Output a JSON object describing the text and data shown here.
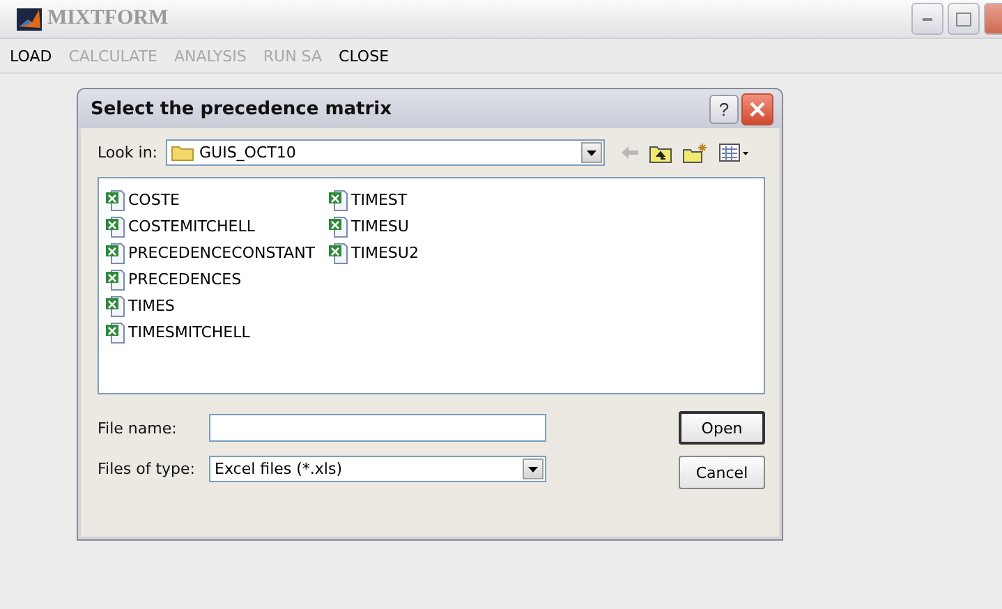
{
  "window": {
    "title": "MIXTFORM"
  },
  "menu": [
    {
      "label": "LOAD",
      "disabled": false
    },
    {
      "label": "CALCULATE",
      "disabled": true
    },
    {
      "label": "ANALYSIS",
      "disabled": true
    },
    {
      "label": "RUN SA",
      "disabled": true
    },
    {
      "label": "CLOSE",
      "disabled": false
    }
  ],
  "dialog": {
    "title": "Select the precedence matrix",
    "help_button": "?",
    "look_in": {
      "label": "Look in:",
      "value": "GUIS_OCT10"
    },
    "files": [
      "COSTE",
      "COSTEMITCHELL",
      "PRECEDENCECONSTANT",
      "PRECEDENCES",
      "TIMES",
      "TIMESMITCHELL",
      "TIMEST",
      "TIMESU",
      "TIMESU2"
    ],
    "file_name": {
      "label": "File name:"
    },
    "file_type": {
      "label": "Files of type:",
      "value": "Excel files (*.xls)"
    },
    "buttons": [
      {
        "label": "Open",
        "default": true
      },
      {
        "label": "Cancel",
        "default": false
      }
    ]
  }
}
